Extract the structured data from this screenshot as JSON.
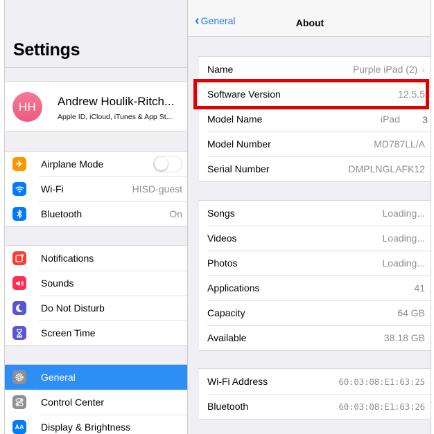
{
  "left": {
    "title": "Settings",
    "profile": {
      "initials": "HH",
      "name": "Andrew Houlik-Ritch...",
      "subtitle": "Apple ID, iCloud, iTunes & App St..."
    },
    "group1": [
      {
        "label": "Airplane Mode",
        "icon": "airplane-icon",
        "color": "#ff9500",
        "toggle": true
      },
      {
        "label": "Wi-Fi",
        "icon": "wifi-icon",
        "color": "#007aff",
        "value": "HISD-guest"
      },
      {
        "label": "Bluetooth",
        "icon": "bluetooth-icon",
        "color": "#007aff",
        "value": "On"
      }
    ],
    "group2": [
      {
        "label": "Notifications",
        "icon": "notifications-icon",
        "color": "#ff3b30"
      },
      {
        "label": "Sounds",
        "icon": "sounds-icon",
        "color": "#ff2d55"
      },
      {
        "label": "Do Not Disturb",
        "icon": "moon-icon",
        "color": "#5856d6"
      },
      {
        "label": "Screen Time",
        "icon": "hourglass-icon",
        "color": "#5856d6"
      }
    ],
    "group3": [
      {
        "label": "General",
        "icon": "gear-icon",
        "color": "#8e8e93",
        "active": true
      },
      {
        "label": "Control Center",
        "icon": "control-center-icon",
        "color": "#8e8e93"
      },
      {
        "label": "Display & Brightness",
        "icon": "display-icon",
        "color": "#007aff"
      }
    ]
  },
  "right": {
    "back_label": "General",
    "title": "About",
    "group1": [
      {
        "label": "Name",
        "value": "Purple iPad (2)"
      },
      {
        "label": "Software Version",
        "value": "12.5.5"
      },
      {
        "label": "Model Name",
        "value": "iPad"
      },
      {
        "label": "Model Number",
        "value": "MD787LL/A"
      },
      {
        "label": "Serial Number",
        "value": "DMPLNGLAFK12"
      }
    ],
    "group2": [
      {
        "label": "Songs",
        "value": "Loading..."
      },
      {
        "label": "Videos",
        "value": "Loading..."
      },
      {
        "label": "Photos",
        "value": "Loading..."
      },
      {
        "label": "Applications",
        "value": "41"
      },
      {
        "label": "Capacity",
        "value": "64 GB"
      },
      {
        "label": "Available",
        "value": "38.18 GB"
      }
    ],
    "group3": [
      {
        "label": "Wi-Fi Address",
        "value": "60:03:08:E1:63:25"
      },
      {
        "label": "Bluetooth",
        "value": "60:03:08:E1:63:26"
      }
    ],
    "marker": "3"
  },
  "colors": {
    "accent": "#1a7cf5",
    "selected_row": "#2d8ef5",
    "highlight_box": "#e10000"
  }
}
